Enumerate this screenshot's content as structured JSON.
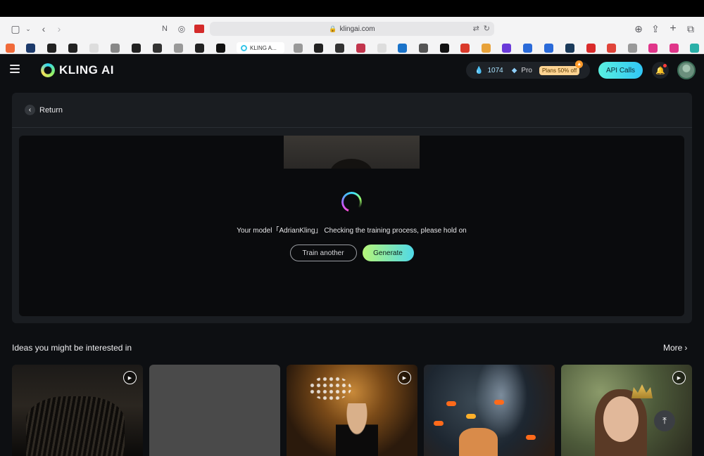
{
  "browser": {
    "url": "klingai.com",
    "active_tab_label": "KLING A..."
  },
  "header": {
    "logo_text": "KLING AI",
    "credits": "1074",
    "plan": "Pro",
    "promo": "Plans 50% off",
    "api_button": "API Calls"
  },
  "panel": {
    "return_label": "Return",
    "status_text": "Your model「AdrianKling」 Checking the training process, please hold on",
    "train_another_label": "Train another",
    "generate_label": "Generate"
  },
  "ideas": {
    "title": "Ideas you might be interested in",
    "more_label": "More"
  },
  "colors": {
    "accent_gradient_start": "#b6f578",
    "accent_gradient_end": "#4fd9e8",
    "app_background": "#0d0f12"
  }
}
